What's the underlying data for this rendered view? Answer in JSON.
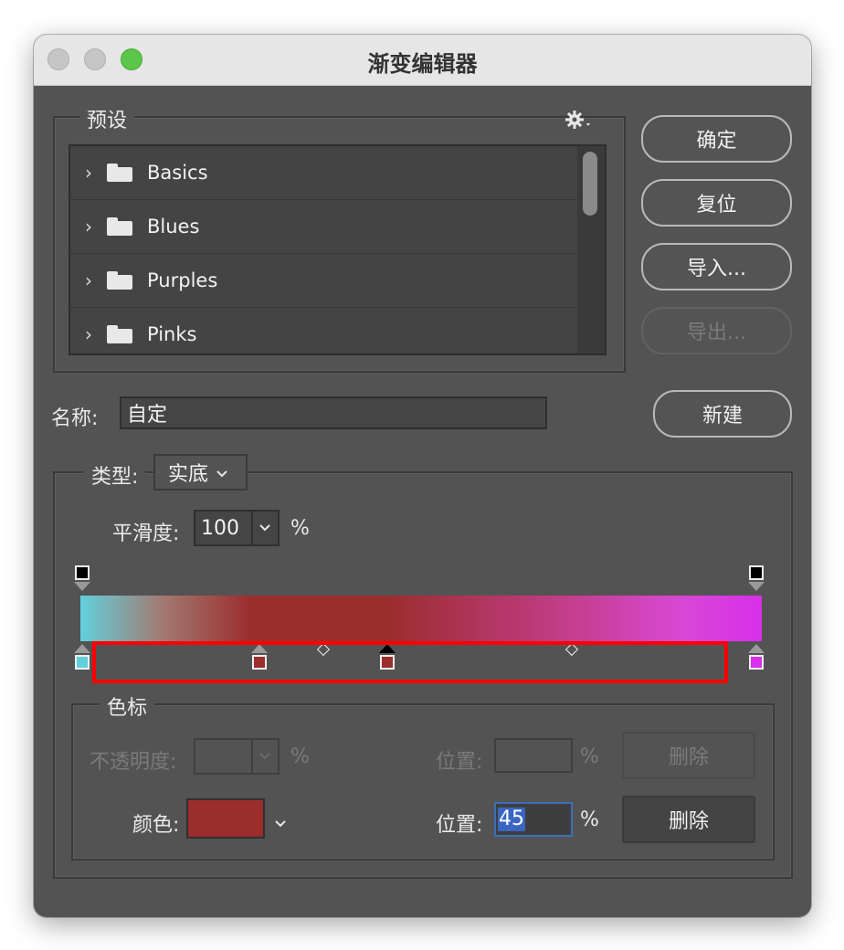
{
  "window": {
    "title": "渐变编辑器"
  },
  "presets": {
    "legend": "预设",
    "gear_icon": "gear-icon",
    "items": [
      {
        "label": "Basics"
      },
      {
        "label": "Blues"
      },
      {
        "label": "Purples"
      },
      {
        "label": "Pinks"
      }
    ]
  },
  "buttons": {
    "ok": "确定",
    "reset": "复位",
    "import": "导入...",
    "export": "导出...",
    "new": "新建"
  },
  "name": {
    "label": "名称:",
    "value": "自定"
  },
  "type": {
    "label": "类型:",
    "value": "实底"
  },
  "smoothness": {
    "label": "平滑度:",
    "value": "100",
    "unit": "%"
  },
  "stops": {
    "legend": "色标",
    "opacity_label": "不透明度:",
    "opacity_unit": "%",
    "opacity_position_label": "位置:",
    "opacity_position_unit": "%",
    "opacity_delete": "删除",
    "color_label": "颜色:",
    "color_value": "#9b2d2d",
    "color_position_label": "位置:",
    "color_position_value": "45",
    "color_position_unit": "%",
    "color_delete": "删除"
  },
  "colors": {
    "stop_left": "#62d0dc",
    "stop_mid": "#9b2d2d",
    "stop_right": "#d82fea"
  }
}
